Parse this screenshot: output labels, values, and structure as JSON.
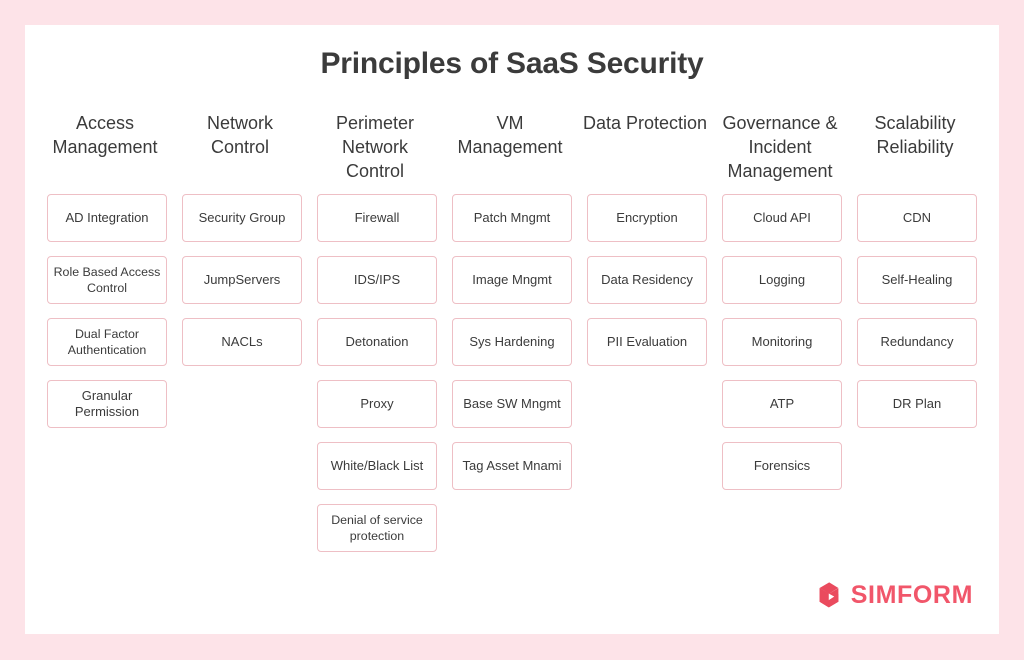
{
  "title": "Principles of SaaS Security",
  "brand": {
    "wordmark": "SIMFORM",
    "mark_icon": "simform-logo-icon",
    "color": "#f1566a"
  },
  "theme": {
    "frame_background": "#fde3e8",
    "card_background": "#ffffff",
    "box_border": "#eebfc5",
    "text_color": "#3b3b3b"
  },
  "columns": [
    {
      "header": "Access Management",
      "items": [
        {
          "label": "AD Integration"
        },
        {
          "label": "Role Based Access Control"
        },
        {
          "label": "Dual Factor Authentication"
        },
        {
          "label": "Granular Permission"
        }
      ]
    },
    {
      "header": "Network Control",
      "items": [
        {
          "label": "Security Group"
        },
        {
          "label": "JumpServers"
        },
        {
          "label": "NACLs"
        }
      ]
    },
    {
      "header": "Perimeter Network Control",
      "items": [
        {
          "label": "Firewall"
        },
        {
          "label": "IDS/IPS"
        },
        {
          "label": "Detonation"
        },
        {
          "label": "Proxy"
        },
        {
          "label": "White/Black List"
        },
        {
          "label": "Denial of service protection"
        }
      ]
    },
    {
      "header": "VM Management",
      "items": [
        {
          "label": "Patch Mngmt"
        },
        {
          "label": "Image Mngmt"
        },
        {
          "label": "Sys Hardening"
        },
        {
          "label": "Base SW Mngmt"
        },
        {
          "label": "Tag Asset Mnami"
        }
      ]
    },
    {
      "header": "Data Protection",
      "items": [
        {
          "label": "Encryption"
        },
        {
          "label": "Data Residency"
        },
        {
          "label": "PII Evaluation"
        }
      ]
    },
    {
      "header": "Governance & Incident Management",
      "items": [
        {
          "label": "Cloud API"
        },
        {
          "label": "Logging"
        },
        {
          "label": "Monitoring"
        },
        {
          "label": "ATP"
        },
        {
          "label": "Forensics"
        }
      ]
    },
    {
      "header": "Scalability Reliability",
      "items": [
        {
          "label": "CDN"
        },
        {
          "label": "Self-Healing"
        },
        {
          "label": "Redundancy"
        },
        {
          "label": "DR Plan"
        }
      ]
    }
  ]
}
